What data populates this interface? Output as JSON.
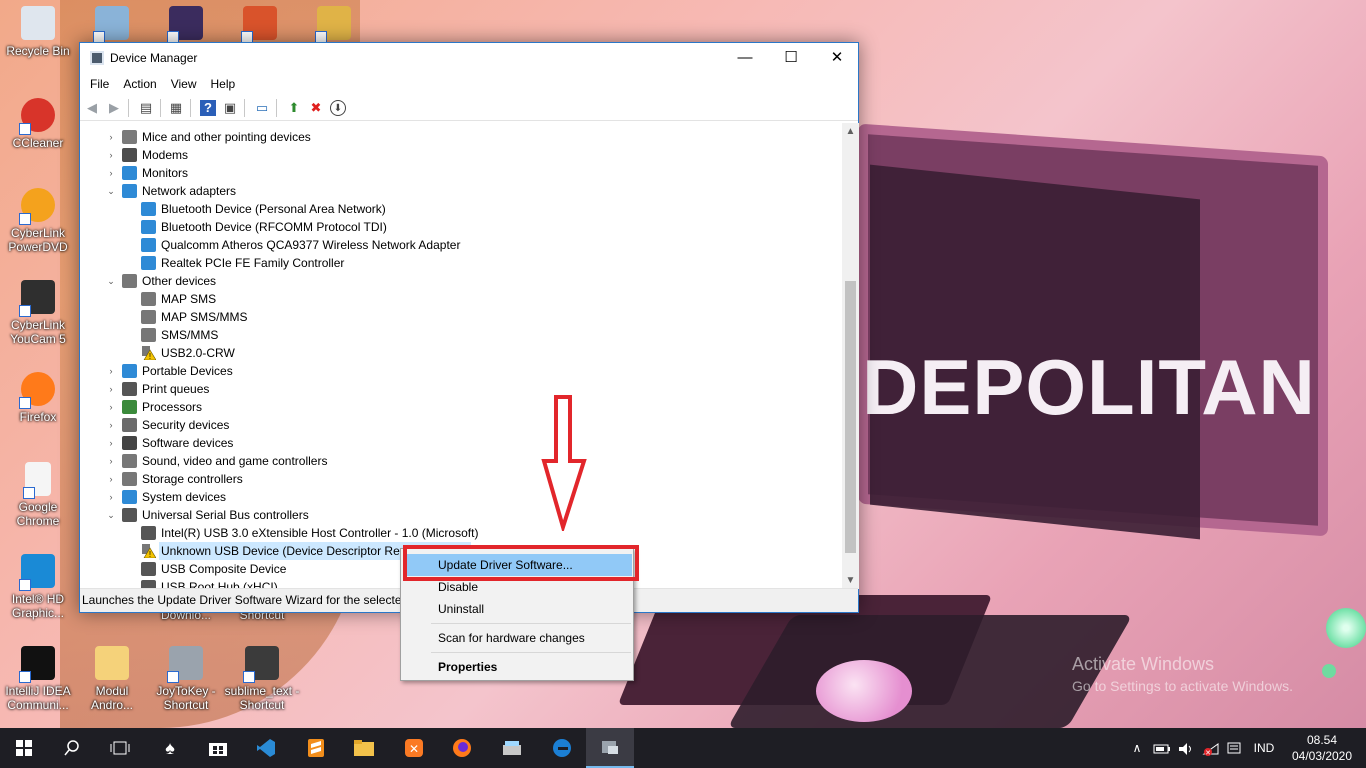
{
  "desktop": {
    "icons": [
      {
        "label": "Recycle Bin",
        "color": "#dfe6ee"
      },
      {
        "label": "",
        "color": "#8ab3d8"
      },
      {
        "label": "",
        "color": "#3b2c5e"
      },
      {
        "label": "",
        "color": "#d9532b"
      },
      {
        "label": "",
        "color": "#e0b347"
      },
      {
        "label": "CCleaner",
        "color": "#d8342a"
      },
      {
        "label": "CyberLink PowerDVD",
        "color": "#f4a21d"
      },
      {
        "label": "CyberLink YouCam 5",
        "color": "#2f2f2f"
      },
      {
        "label": "Firefox",
        "color": "#ff7a1a"
      },
      {
        "label": "Google Chrome",
        "color": "#f5f5f5"
      },
      {
        "label": "Intel® HD Graphic...",
        "color": "#1a8ad6"
      },
      {
        "label": "Downlo...",
        "color": "#c7a15a"
      },
      {
        "label": "Shortcut",
        "color": "#444"
      },
      {
        "label": "IntelliJ IDEA Communi...",
        "color": "#111"
      },
      {
        "label": "Modul Andro...",
        "color": "#f5d27a"
      },
      {
        "label": "JoyToKey - Shortcut",
        "color": "#9aa3ad"
      },
      {
        "label": "sublime_text - Shortcut",
        "color": "#3b3b3b"
      }
    ],
    "wallpaper_text": "DEPOLITAN",
    "activate": {
      "line1": "Activate Windows",
      "line2": "Go to Settings to activate Windows."
    }
  },
  "window": {
    "title": "Device Manager",
    "controls": {
      "minimize": "—",
      "maximize": "☐",
      "close": "✕"
    },
    "menu": [
      "File",
      "Action",
      "View",
      "Help"
    ],
    "toolbar_icons": [
      "back-icon",
      "forward-icon",
      "show-hide-icon",
      "properties-icon",
      "help-icon",
      "console-icon",
      "monitor-icon",
      "update-driver-icon",
      "uninstall-icon",
      "download-icon"
    ],
    "tree": [
      {
        "label": "Mice and other pointing devices",
        "level": 0,
        "expander": "›",
        "icon": "mouse"
      },
      {
        "label": "Modems",
        "level": 0,
        "expander": "›",
        "icon": "modem"
      },
      {
        "label": "Monitors",
        "level": 0,
        "expander": "›",
        "icon": "monitor"
      },
      {
        "label": "Network adapters",
        "level": 0,
        "expander": "⌄",
        "icon": "network"
      },
      {
        "label": "Bluetooth Device (Personal Area Network)",
        "level": 1,
        "expander": "",
        "icon": "network"
      },
      {
        "label": "Bluetooth Device (RFCOMM Protocol TDI)",
        "level": 1,
        "expander": "",
        "icon": "network"
      },
      {
        "label": "Qualcomm Atheros QCA9377 Wireless Network Adapter",
        "level": 1,
        "expander": "",
        "icon": "network"
      },
      {
        "label": "Realtek PCIe FE Family Controller",
        "level": 1,
        "expander": "",
        "icon": "network"
      },
      {
        "label": "Other devices",
        "level": 0,
        "expander": "⌄",
        "icon": "other"
      },
      {
        "label": "MAP SMS",
        "level": 1,
        "expander": "",
        "icon": "other"
      },
      {
        "label": "MAP SMS/MMS",
        "level": 1,
        "expander": "",
        "icon": "other"
      },
      {
        "label": "SMS/MMS",
        "level": 1,
        "expander": "",
        "icon": "other"
      },
      {
        "label": "USB2.0-CRW",
        "level": 1,
        "expander": "",
        "icon": "warning"
      },
      {
        "label": "Portable Devices",
        "level": 0,
        "expander": "›",
        "icon": "portable"
      },
      {
        "label": "Print queues",
        "level": 0,
        "expander": "›",
        "icon": "printer"
      },
      {
        "label": "Processors",
        "level": 0,
        "expander": "›",
        "icon": "processor"
      },
      {
        "label": "Security devices",
        "level": 0,
        "expander": "›",
        "icon": "security"
      },
      {
        "label": "Software devices",
        "level": 0,
        "expander": "›",
        "icon": "software"
      },
      {
        "label": "Sound, video and game controllers",
        "level": 0,
        "expander": "›",
        "icon": "sound"
      },
      {
        "label": "Storage controllers",
        "level": 0,
        "expander": "›",
        "icon": "storage"
      },
      {
        "label": "System devices",
        "level": 0,
        "expander": "›",
        "icon": "system"
      },
      {
        "label": "Universal Serial Bus controllers",
        "level": 0,
        "expander": "⌄",
        "icon": "usb"
      },
      {
        "label": "Intel(R) USB 3.0 eXtensible Host Controller - 1.0 (Microsoft)",
        "level": 1,
        "expander": "",
        "icon": "usb"
      },
      {
        "label": "Unknown USB Device (Device Descriptor Request Failed)",
        "level": 1,
        "expander": "",
        "icon": "warning",
        "selected": true
      },
      {
        "label": "USB Composite Device",
        "level": 1,
        "expander": "",
        "icon": "usb"
      },
      {
        "label": "USB Root Hub (xHCI)",
        "level": 1,
        "expander": "",
        "icon": "usb"
      }
    ],
    "status": "Launches the Update Driver Software Wizard for the selected"
  },
  "context_menu": {
    "update": "Update Driver Software...",
    "disable": "Disable",
    "uninstall": "Uninstall",
    "scan": "Scan for hardware changes",
    "properties": "Properties"
  },
  "taskbar": {
    "apps": [
      "start-icon",
      "search-icon",
      "task-view-icon",
      "solitaire-icon",
      "store-icon",
      "vscode-icon",
      "sublime-icon",
      "file-explorer-icon",
      "xampp-icon",
      "firefox-icon",
      "scanner-icon",
      "edge-icon",
      "device-manager-icon"
    ],
    "tray": {
      "chevron": "∧",
      "language": "IND"
    },
    "time": "08.54",
    "date": "04/03/2020"
  },
  "colors": {
    "highlight_red": "#e2262b",
    "menu_hover": "#91c9f7",
    "selection": "#cce8ff"
  }
}
